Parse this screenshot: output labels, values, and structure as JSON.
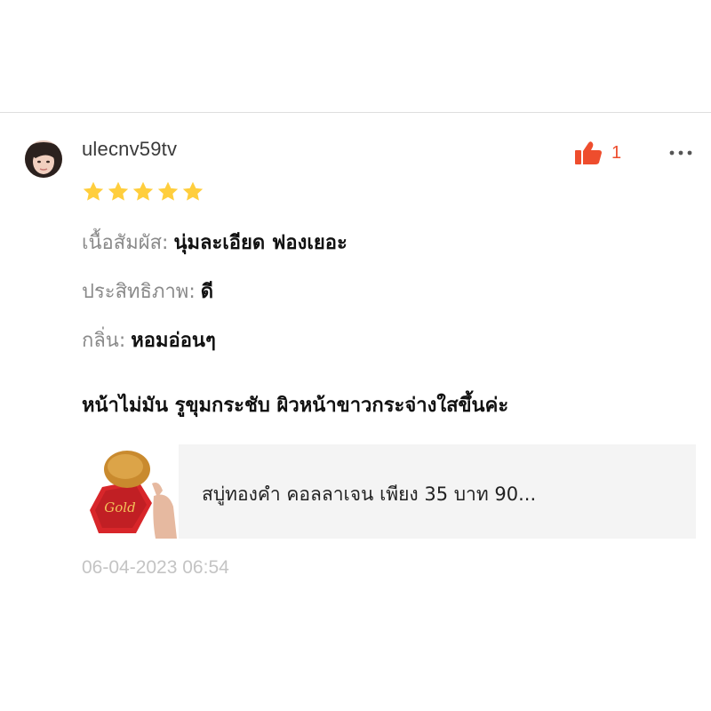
{
  "review": {
    "username": "ulecnv59tv",
    "likes": "1",
    "rating": 5,
    "attributes": [
      {
        "label": "เนื้อสัมผัส:",
        "value": "นุ่มละเอียด ฟองเยอะ"
      },
      {
        "label": "ประสิทธิภาพ:",
        "value": "ดี"
      },
      {
        "label": "กลิ่น:",
        "value": "หอมอ่อนๆ"
      }
    ],
    "body": "หน้าไม่มัน รูขุมกระชับ ผิวหน้าขาวกระจ่างใสขึ้นค่ะ",
    "product_title": "สบู่ทองคำ คอลลาเจน เพียง 35 บาท 90...",
    "product_image_label": "Gold",
    "timestamp": "06-04-2023 06:54"
  },
  "icons": {
    "like": "thumbs-up-icon",
    "more": "more-options-icon",
    "star": "star-icon"
  },
  "colors": {
    "accent": "#ee4d2d",
    "star": "#ffce3d",
    "timestamp": "#c4c4c4",
    "label": "#8a8a8a"
  }
}
